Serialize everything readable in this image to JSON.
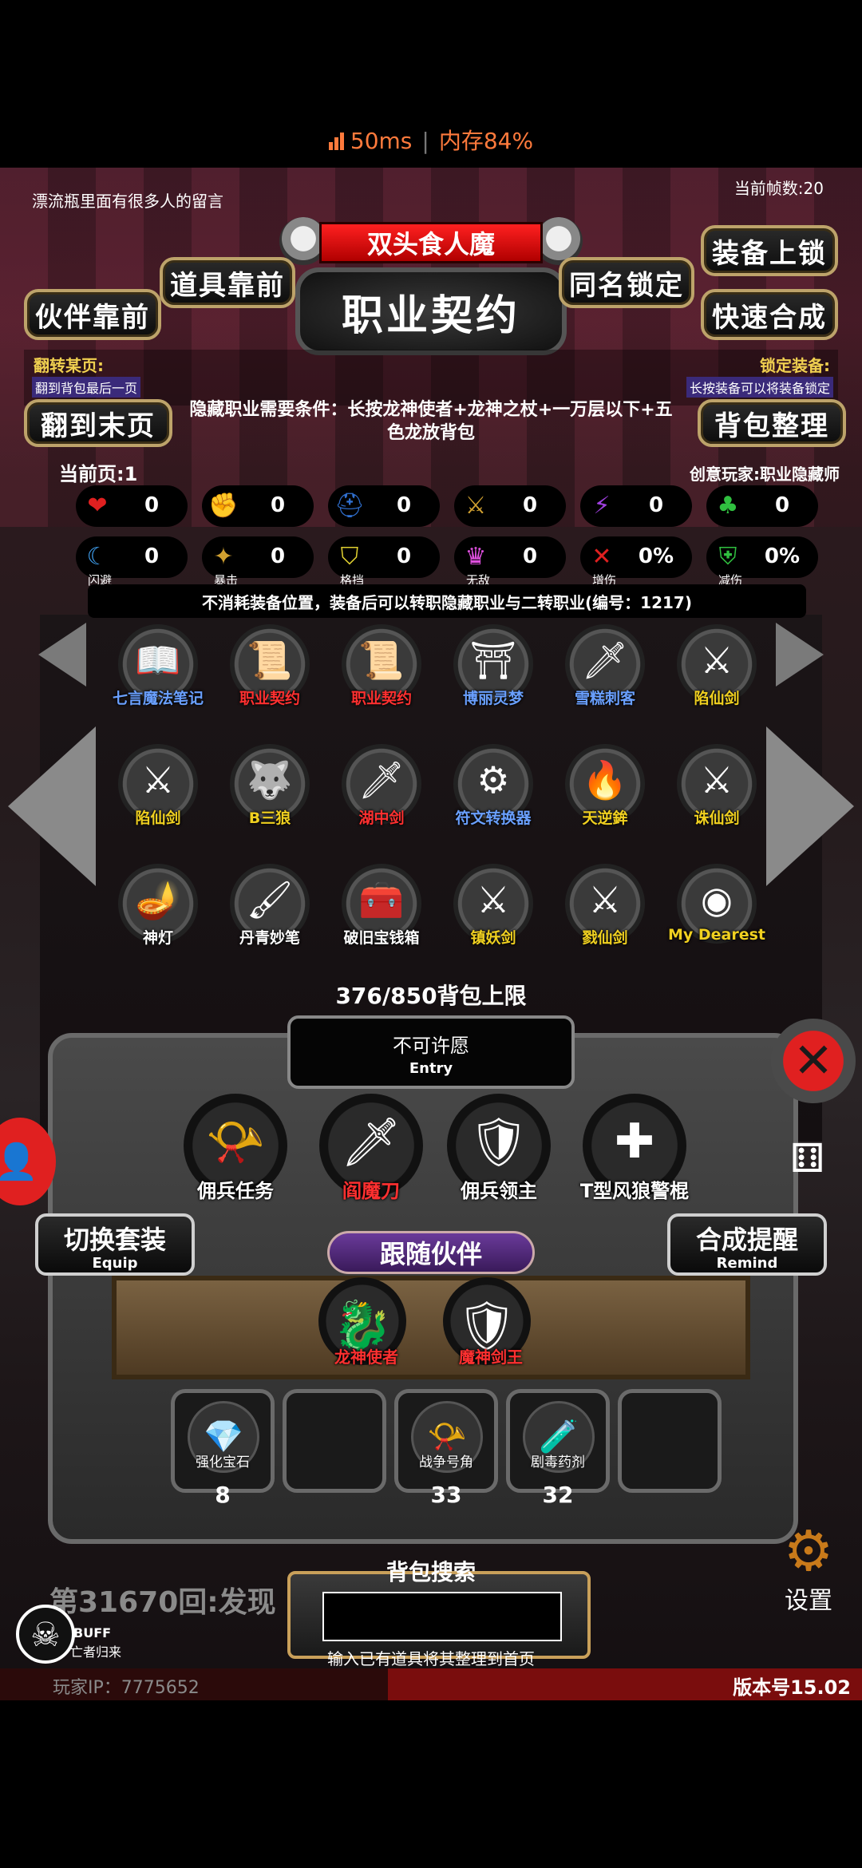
{
  "status": {
    "ping": "50ms",
    "memory": "内存84%"
  },
  "header": {
    "message_bottle": "漂流瓶里面有很多人的留言",
    "fps": "当前帧数:20",
    "boss_name": "双头食人魔",
    "title": "职业契约"
  },
  "buttons": {
    "items_front": "道具靠前",
    "partner_front": "伙伴靠前",
    "same_name_lock": "同名锁定",
    "equip_lock": "装备上锁",
    "quick_merge": "快速合成",
    "to_last_page": "翻到末页",
    "bag_sort": "背包整理"
  },
  "flip": {
    "label": "翻转某页:",
    "sub": "翻到背包最后一页"
  },
  "lock": {
    "label": "锁定装备:",
    "sub": "长按装备可以将装备锁定"
  },
  "requirement": "隐藏职业需要条件：长按龙神使者+龙神之杖+一万层以下+五色龙放背包",
  "current_page": "当前页:1",
  "creator": "创意玩家:职业隐藏师",
  "stats_row1": [
    {
      "icon": "heart-icon",
      "glyph": "❤",
      "color": "#e02020",
      "value": "0"
    },
    {
      "icon": "strength-icon",
      "glyph": "✊",
      "color": "#e0b030",
      "value": "0"
    },
    {
      "icon": "helmet-icon",
      "glyph": "⛑",
      "color": "#3070d0",
      "value": "0"
    },
    {
      "icon": "sword-icon",
      "glyph": "⚔",
      "color": "#d0a030",
      "value": "0"
    },
    {
      "icon": "lightning-icon",
      "glyph": "⚡",
      "color": "#a040e0",
      "value": "0"
    },
    {
      "icon": "clover-icon",
      "glyph": "♣",
      "color": "#30c040",
      "value": "0"
    }
  ],
  "stats_row2": [
    {
      "icon": "dodge-icon",
      "glyph": "☾",
      "color": "#40a0f0",
      "value": "0",
      "label": "闪避"
    },
    {
      "icon": "crit-icon",
      "glyph": "✦",
      "color": "#d0a030",
      "value": "0",
      "label": "暴击"
    },
    {
      "icon": "block-icon",
      "glyph": "⛉",
      "color": "#e0d030",
      "value": "0",
      "label": "格挡"
    },
    {
      "icon": "invincible-icon",
      "glyph": "♛",
      "color": "#e050e0",
      "value": "0",
      "label": "无敌"
    },
    {
      "icon": "damage-up-icon",
      "glyph": "✕",
      "color": "#e02020",
      "value": "0%",
      "label": "增伤"
    },
    {
      "icon": "damage-down-icon",
      "glyph": "⛨",
      "color": "#30c040",
      "value": "0%",
      "label": "减伤"
    }
  ],
  "item_description": "不消耗装备位置，装备后可以转职隐藏职业与二转职业(编号：1217)",
  "items": [
    {
      "label": "七言魔法笔记",
      "color": "#6aa0ff",
      "glyph": "📖"
    },
    {
      "label": "职业契约",
      "color": "#ff3030",
      "glyph": "📜"
    },
    {
      "label": "职业契约",
      "color": "#ff3030",
      "glyph": "📜"
    },
    {
      "label": "博丽灵梦",
      "color": "#6aa0ff",
      "glyph": "⛩"
    },
    {
      "label": "雪糕刺客",
      "color": "#6aa0ff",
      "glyph": "🗡"
    },
    {
      "label": "陷仙剑",
      "color": "#f0d020",
      "glyph": "⚔"
    },
    {
      "label": "陷仙剑",
      "color": "#f0d020",
      "glyph": "⚔"
    },
    {
      "label": "B三狼",
      "color": "#f0d020",
      "glyph": "🐺"
    },
    {
      "label": "湖中剑",
      "color": "#ff3030",
      "glyph": "🗡"
    },
    {
      "label": "符文转换器",
      "color": "#6aa0ff",
      "glyph": "⚙"
    },
    {
      "label": "天逆鉾",
      "color": "#f0d020",
      "glyph": "🔥"
    },
    {
      "label": "诛仙剑",
      "color": "#f0d020",
      "glyph": "⚔"
    },
    {
      "label": "神灯",
      "color": "#ffffff",
      "glyph": "🪔"
    },
    {
      "label": "丹青妙笔",
      "color": "#ffffff",
      "glyph": "🖌"
    },
    {
      "label": "破旧宝钱箱",
      "color": "#ffffff",
      "glyph": "🧰"
    },
    {
      "label": "镇妖剑",
      "color": "#f0d020",
      "glyph": "⚔"
    },
    {
      "label": "戮仙剑",
      "color": "#f0d020",
      "glyph": "⚔"
    },
    {
      "label": "My Dearest",
      "color": "#f0d020",
      "glyph": "◉"
    }
  ],
  "bag_limit": "376/850背包上限",
  "entry": {
    "title": "不可许愿",
    "sub": "Entry"
  },
  "mercs": [
    {
      "label": "佣兵任务",
      "color": "#ffffff",
      "glyph": "📯"
    },
    {
      "label": "阎魔刀",
      "color": "#ff3030",
      "glyph": "🗡"
    },
    {
      "label": "佣兵领主",
      "color": "#ffffff",
      "glyph": "🛡"
    },
    {
      "label": "T型风狼警棍",
      "color": "#ffffff",
      "glyph": "✚"
    }
  ],
  "switch_suit": {
    "label": "切换套装",
    "sub": "Equip"
  },
  "merge_remind": {
    "label": "合成提醒",
    "sub": "Remind"
  },
  "follow_partner": "跟随伙伴",
  "partners": [
    {
      "label": "龙神使者",
      "color": "#ff3030",
      "glyph": "🐉"
    },
    {
      "label": "魔神剑王",
      "color": "#ff3030",
      "glyph": "🛡"
    }
  ],
  "slots": [
    {
      "label": "强化宝石",
      "count": "8",
      "glyph": "💎"
    },
    {
      "label": "",
      "count": "",
      "glyph": ""
    },
    {
      "label": "战争号角",
      "count": "33",
      "glyph": "📯"
    },
    {
      "label": "剧毒药剂",
      "count": "32",
      "glyph": "🧪"
    },
    {
      "label": "",
      "count": "",
      "glyph": ""
    }
  ],
  "search": {
    "title": "背包搜索",
    "hint": "输入已有道具将其整理到首页",
    "value": ""
  },
  "footer": {
    "round_text": "第31670回:发现",
    "buff_label": "BUFF",
    "buff_sub": "亡者归来",
    "player_ip": "玩家IP：7775652",
    "version": "版本号15.02",
    "settings": "设置"
  }
}
